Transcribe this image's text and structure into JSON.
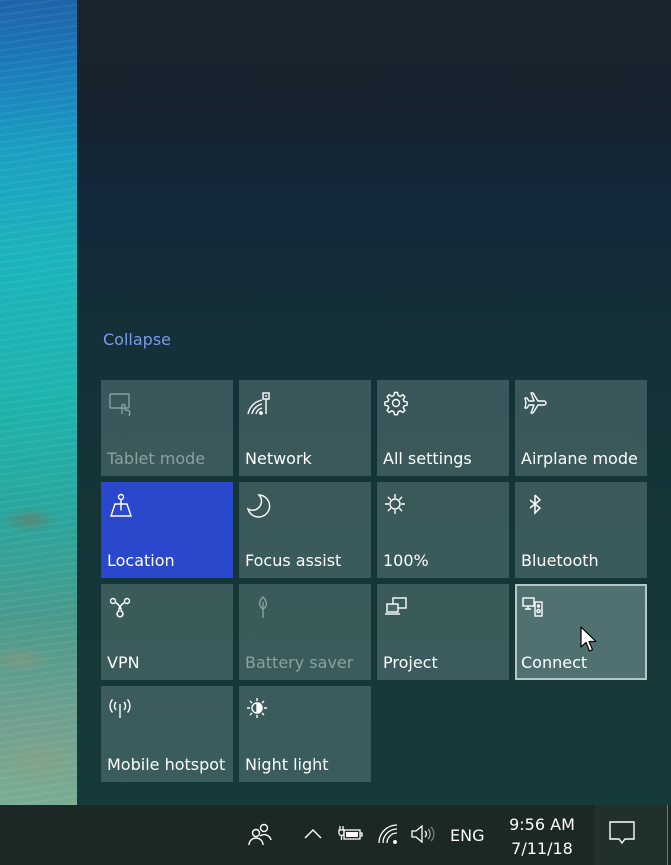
{
  "action_center": {
    "collapse_label": "Collapse",
    "tiles": [
      {
        "label": "Tablet mode",
        "icon": "tablet-mode-icon",
        "state": "disabled"
      },
      {
        "label": "Network",
        "icon": "network-icon",
        "state": "normal"
      },
      {
        "label": "All settings",
        "icon": "gear-icon",
        "state": "normal"
      },
      {
        "label": "Airplane mode",
        "icon": "airplane-icon",
        "state": "normal"
      },
      {
        "label": "Location",
        "icon": "location-icon",
        "state": "active"
      },
      {
        "label": "Focus assist",
        "icon": "moon-icon",
        "state": "normal"
      },
      {
        "label": "100%",
        "icon": "brightness-icon",
        "state": "normal"
      },
      {
        "label": "Bluetooth",
        "icon": "bluetooth-icon",
        "state": "normal"
      },
      {
        "label": "VPN",
        "icon": "vpn-icon",
        "state": "normal"
      },
      {
        "label": "Battery saver",
        "icon": "leaf-icon",
        "state": "disabled"
      },
      {
        "label": "Project",
        "icon": "project-icon",
        "state": "normal"
      },
      {
        "label": "Connect",
        "icon": "connect-icon",
        "state": "hover"
      },
      {
        "label": "Mobile hotspot",
        "icon": "hotspot-icon",
        "state": "normal"
      },
      {
        "label": "Night light",
        "icon": "night-light-icon",
        "state": "normal"
      }
    ]
  },
  "taskbar": {
    "people_icon": "people-icon",
    "overflow_icon": "chevron-up-icon",
    "battery_icon": "battery-charging-icon",
    "wifi_icon": "wifi-icon",
    "volume_icon": "volume-icon",
    "language": "ENG",
    "time": "9:56 AM",
    "date": "7/11/18",
    "notification_icon": "action-center-icon"
  },
  "colors": {
    "accent": "#2a48cc",
    "collapse_link": "#7b9ae8"
  }
}
